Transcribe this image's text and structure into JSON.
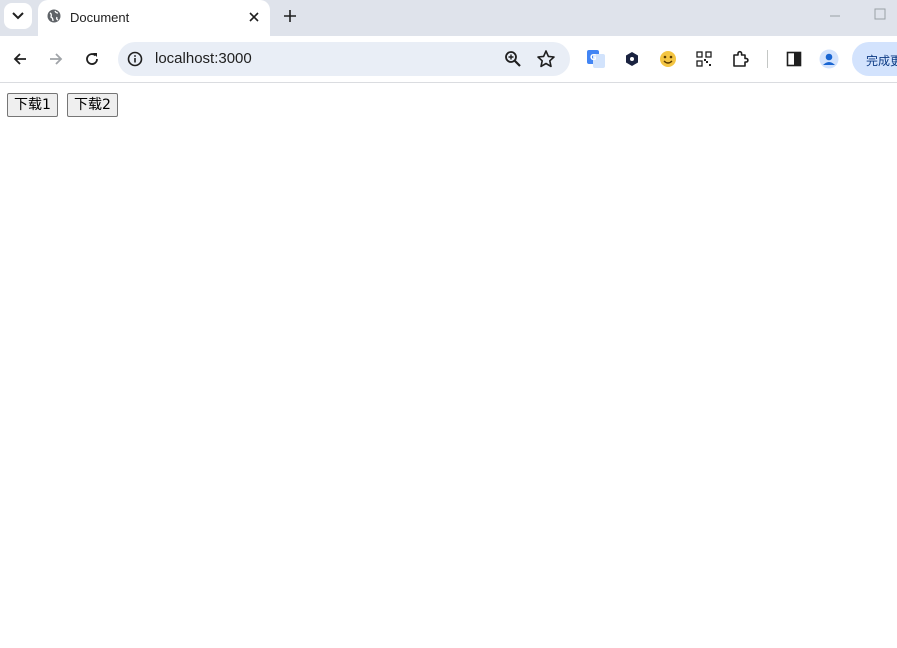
{
  "browser": {
    "tab": {
      "title": "Document",
      "favicon": "globe-icon"
    },
    "address_bar": {
      "url": "localhost:3000"
    },
    "extensions": [
      "translate-icon",
      "hexagon-extension-icon",
      "emoji-extension-icon",
      "qr-code-icon",
      "puzzle-extensions-icon"
    ],
    "finish_button_label": "完成更"
  },
  "page": {
    "buttons": [
      {
        "label": "下载1"
      },
      {
        "label": "下载2"
      }
    ]
  },
  "colors": {
    "tabbar_bg": "#dfe3eb",
    "omnibox_bg": "#e9eef6",
    "accent_button_bg": "#d3e3fd"
  }
}
